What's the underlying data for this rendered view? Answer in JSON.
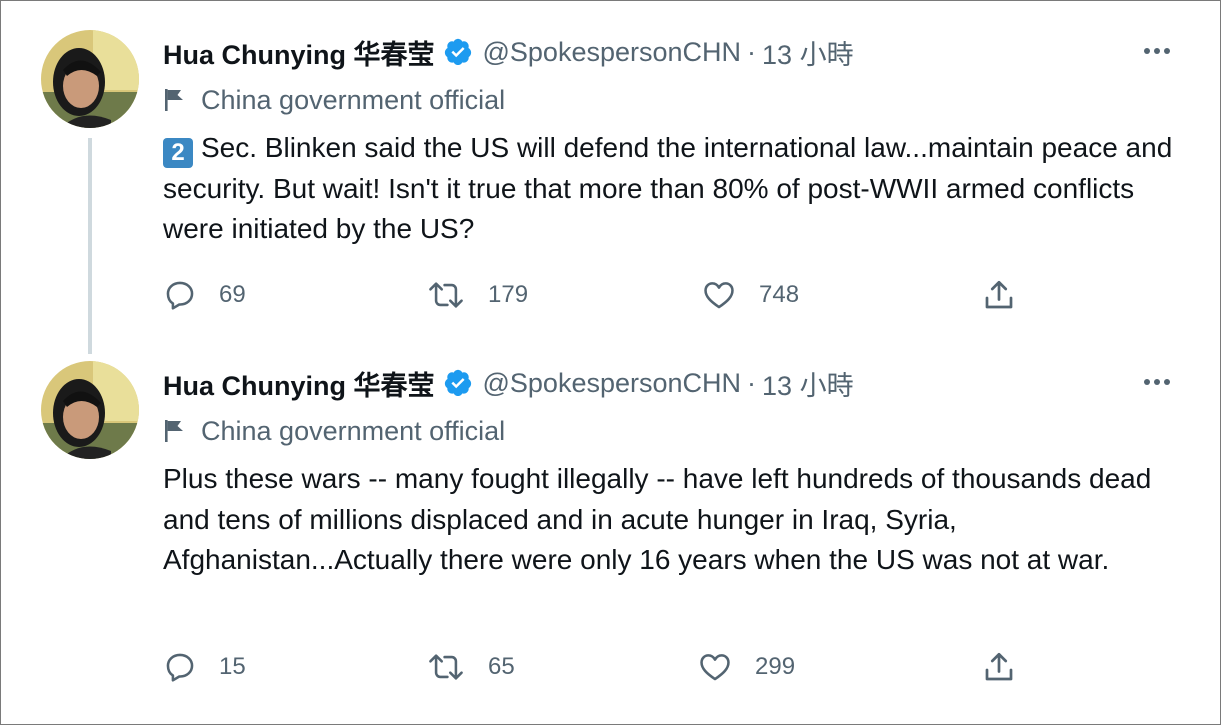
{
  "tweets": [
    {
      "author": {
        "display_name": "Hua Chunying 华春莹",
        "handle": "@SpokespersonCHN",
        "separator": "·",
        "time": "13 小時",
        "label": "China government official"
      },
      "body_prefix_emoji": "2",
      "body": "Sec. Blinken said the US will defend the international law...maintain peace and security. But wait! Isn't it true that more than 80% of post-WWII armed conflicts were initiated by the US?",
      "replies": "69",
      "retweets": "179",
      "likes": "748"
    },
    {
      "author": {
        "display_name": "Hua Chunying 华春莹",
        "handle": "@SpokespersonCHN",
        "separator": "·",
        "time": "13 小時",
        "label": "China government official"
      },
      "body": "Plus these wars -- many fought illegally -- have left hundreds of thousands dead and tens of millions displaced and in acute hunger in Iraq, Syria, Afghanistan...Actually there were only 16 years when the US was not at war.",
      "replies": "15",
      "retweets": "65",
      "likes": "299"
    }
  ],
  "icons": {
    "verified": "verified-badge-icon",
    "label": "flag-icon",
    "more": "more-options-icon",
    "reply": "reply-icon",
    "retweet": "retweet-icon",
    "like": "heart-icon",
    "share": "share-icon"
  },
  "colors": {
    "text": "#0f1419",
    "secondary": "#536471",
    "verified": "#1d9bf0",
    "thread_line": "#cfd9de",
    "keycap": "#3b88c3"
  }
}
